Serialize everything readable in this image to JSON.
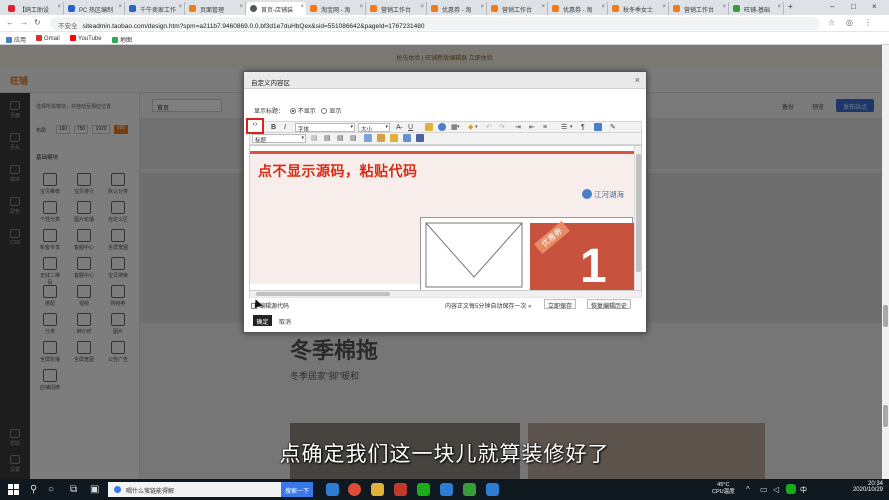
{
  "browser": {
    "tabs": [
      {
        "label": "【鸥工助设"
      },
      {
        "label": "PC 热区编制"
      },
      {
        "label": "千牛卖家工作"
      },
      {
        "label": "页面管理"
      },
      {
        "label": "首页-店铺装",
        "active": true
      },
      {
        "label": "淘宝网 - 淘"
      },
      {
        "label": "营销工作台"
      },
      {
        "label": "优惠券 - 淘"
      },
      {
        "label": "营销工作台"
      },
      {
        "label": "优惠券 - 淘"
      },
      {
        "label": "秋冬季女士"
      },
      {
        "label": "营销工作台"
      },
      {
        "label": "旺铺-基础"
      }
    ],
    "new_tab": "+",
    "insecure_label": "不安全",
    "url": "siteadmin.taobao.com/design.htm?spm=a211b7.9460869.0.0.bf3d1e7duHbQex&sid=551086642&pageId=1767231480",
    "bookmarks": [
      {
        "label": "应用"
      },
      {
        "label": "Gmail"
      },
      {
        "label": "YouTube"
      },
      {
        "label": "地图"
      }
    ]
  },
  "page": {
    "banner_text": "抢先体验 | 旺铺新版编辑器 立即体验",
    "logo": "旺铺",
    "rail_items": [
      "页面",
      "页头",
      "模块",
      "配色",
      "CSS"
    ],
    "rail_bottom": [
      "帮助",
      "设置"
    ],
    "panel_tip": "选择所需模块，并拖动至相应位置",
    "width_label": "布局",
    "widths": [
      "190",
      "750",
      "1920",
      "950"
    ],
    "section_title": "基础模块",
    "modules": [
      "宝贝推荐",
      "宝贝排行",
      "默认分类",
      "个性分类",
      "图片轮播",
      "自定义区",
      "新客专享",
      "客服中心",
      "全屏宽图",
      "无线二维码",
      "客服中心",
      "宝贝搜索",
      "搭配",
      "视频",
      "购物券",
      "分类",
      "倒计时",
      "图片",
      "全屏轮播",
      "全屏宽图",
      "公告广告",
      "店铺招牌"
    ],
    "page_select": "首页",
    "top_buttons": [
      "备份",
      "预览"
    ],
    "publish_button": "发布站点",
    "promo_heading": "冬季棉拖",
    "promo_sub": "冬季居家“脚”暖和"
  },
  "modal": {
    "title": "自定义内容区",
    "close": "×",
    "show_title_label": "显示标题：",
    "radio_hide": "不显示",
    "radio_show": "显示",
    "font_family_select": "字体",
    "font_size_select": "大小",
    "heading_select": "标题",
    "source_button_icon": "‹›",
    "content_caption": "点不显示源码，粘贴代码",
    "brand_name": "江河湖海",
    "coupon_label": "优惠券",
    "coupon_digit": "1",
    "edit_source_label": "编辑源代码",
    "autosave_text": "内容正文每5分钟自动保存一次 »",
    "save_now": "立即保存",
    "restore_history": "恢复编辑历史",
    "confirm_button": "确定",
    "cancel_button": "取消"
  },
  "subtitle": "点确定我们这一块儿就算装修好了",
  "taskbar": {
    "search_placeholder": "喝什么萤链能得解",
    "search_button": "搜索一下",
    "cpu_temp": "45°C",
    "cpu_label": "CPU温度",
    "ime": "中",
    "time": "20:34",
    "date": "2020/10/29"
  },
  "colors": {
    "accent_red": "#e0201a",
    "caption_red": "#d92b16",
    "coupon": "#c7533f",
    "publish_blue": "#3b6fd6",
    "taskbar": "#101820"
  }
}
